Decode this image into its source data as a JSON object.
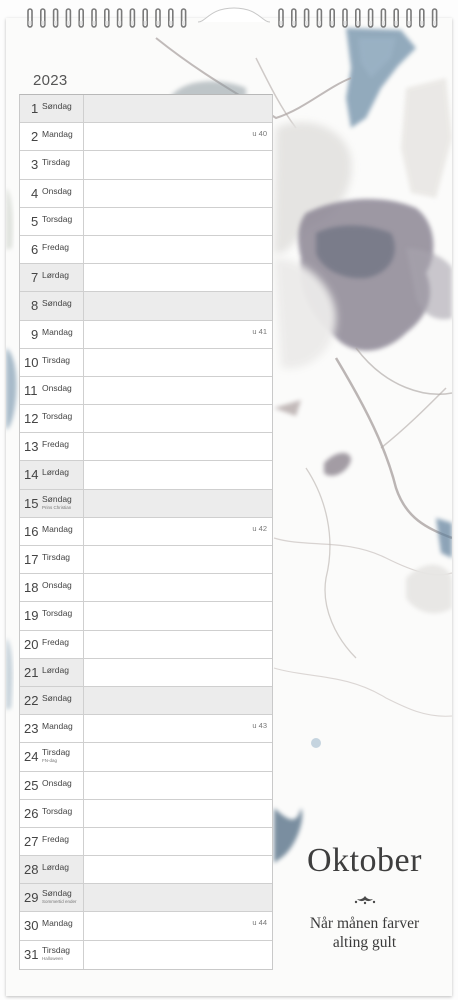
{
  "calendar": {
    "year": "2023",
    "month_title": "Oktober",
    "motto_line1": "Når månen farver",
    "motto_line2": "alting gult",
    "days": [
      {
        "num": "1",
        "name": "Søndag",
        "note": "",
        "week": "",
        "type": "sunday"
      },
      {
        "num": "2",
        "name": "Mandag",
        "note": "",
        "week": "u 40",
        "type": "weekday"
      },
      {
        "num": "3",
        "name": "Tirsdag",
        "note": "",
        "week": "",
        "type": "weekday"
      },
      {
        "num": "4",
        "name": "Onsdag",
        "note": "",
        "week": "",
        "type": "weekday"
      },
      {
        "num": "5",
        "name": "Torsdag",
        "note": "",
        "week": "",
        "type": "weekday"
      },
      {
        "num": "6",
        "name": "Fredag",
        "note": "",
        "week": "",
        "type": "weekday"
      },
      {
        "num": "7",
        "name": "Lørdag",
        "note": "",
        "week": "",
        "type": "weekend"
      },
      {
        "num": "8",
        "name": "Søndag",
        "note": "",
        "week": "",
        "type": "sunday"
      },
      {
        "num": "9",
        "name": "Mandag",
        "note": "",
        "week": "u 41",
        "type": "weekday"
      },
      {
        "num": "10",
        "name": "Tirsdag",
        "note": "",
        "week": "",
        "type": "weekday"
      },
      {
        "num": "11",
        "name": "Onsdag",
        "note": "",
        "week": "",
        "type": "weekday"
      },
      {
        "num": "12",
        "name": "Torsdag",
        "note": "",
        "week": "",
        "type": "weekday"
      },
      {
        "num": "13",
        "name": "Fredag",
        "note": "",
        "week": "",
        "type": "weekday"
      },
      {
        "num": "14",
        "name": "Lørdag",
        "note": "",
        "week": "",
        "type": "weekend"
      },
      {
        "num": "15",
        "name": "Søndag",
        "note": "Prins Christian",
        "week": "",
        "type": "sunday"
      },
      {
        "num": "16",
        "name": "Mandag",
        "note": "",
        "week": "u 42",
        "type": "weekday"
      },
      {
        "num": "17",
        "name": "Tirsdag",
        "note": "",
        "week": "",
        "type": "weekday"
      },
      {
        "num": "18",
        "name": "Onsdag",
        "note": "",
        "week": "",
        "type": "weekday"
      },
      {
        "num": "19",
        "name": "Torsdag",
        "note": "",
        "week": "",
        "type": "weekday"
      },
      {
        "num": "20",
        "name": "Fredag",
        "note": "",
        "week": "",
        "type": "weekday"
      },
      {
        "num": "21",
        "name": "Lørdag",
        "note": "",
        "week": "",
        "type": "weekend"
      },
      {
        "num": "22",
        "name": "Søndag",
        "note": "",
        "week": "",
        "type": "sunday"
      },
      {
        "num": "23",
        "name": "Mandag",
        "note": "",
        "week": "u 43",
        "type": "weekday"
      },
      {
        "num": "24",
        "name": "Tirsdag",
        "note": "FN-dag",
        "week": "",
        "type": "weekday"
      },
      {
        "num": "25",
        "name": "Onsdag",
        "note": "",
        "week": "",
        "type": "weekday"
      },
      {
        "num": "26",
        "name": "Torsdag",
        "note": "",
        "week": "",
        "type": "weekday"
      },
      {
        "num": "27",
        "name": "Fredag",
        "note": "",
        "week": "",
        "type": "weekday"
      },
      {
        "num": "28",
        "name": "Lørdag",
        "note": "",
        "week": "",
        "type": "weekend"
      },
      {
        "num": "29",
        "name": "Søndag",
        "note": "Sommertid ender",
        "week": "",
        "type": "sunday"
      },
      {
        "num": "30",
        "name": "Mandag",
        "note": "",
        "week": "u 44",
        "type": "weekday"
      },
      {
        "num": "31",
        "name": "Tirsdag",
        "note": "Halloween",
        "week": "",
        "type": "weekday"
      }
    ]
  },
  "decor": {
    "spiral_icon": "wire-binding-icon",
    "hanger_icon": "hanger-notch-icon",
    "ornament_icon": "flourish-ornament-icon",
    "artwork": "watercolor-flowers-artwork"
  },
  "colors": {
    "paper": "#fbfbfa",
    "weekend_shade": "#ececec",
    "grid_line": "#cfcfcf",
    "text": "#444444",
    "watercolor_blue": "#6f8fa8",
    "watercolor_grey": "#8e8a96"
  }
}
